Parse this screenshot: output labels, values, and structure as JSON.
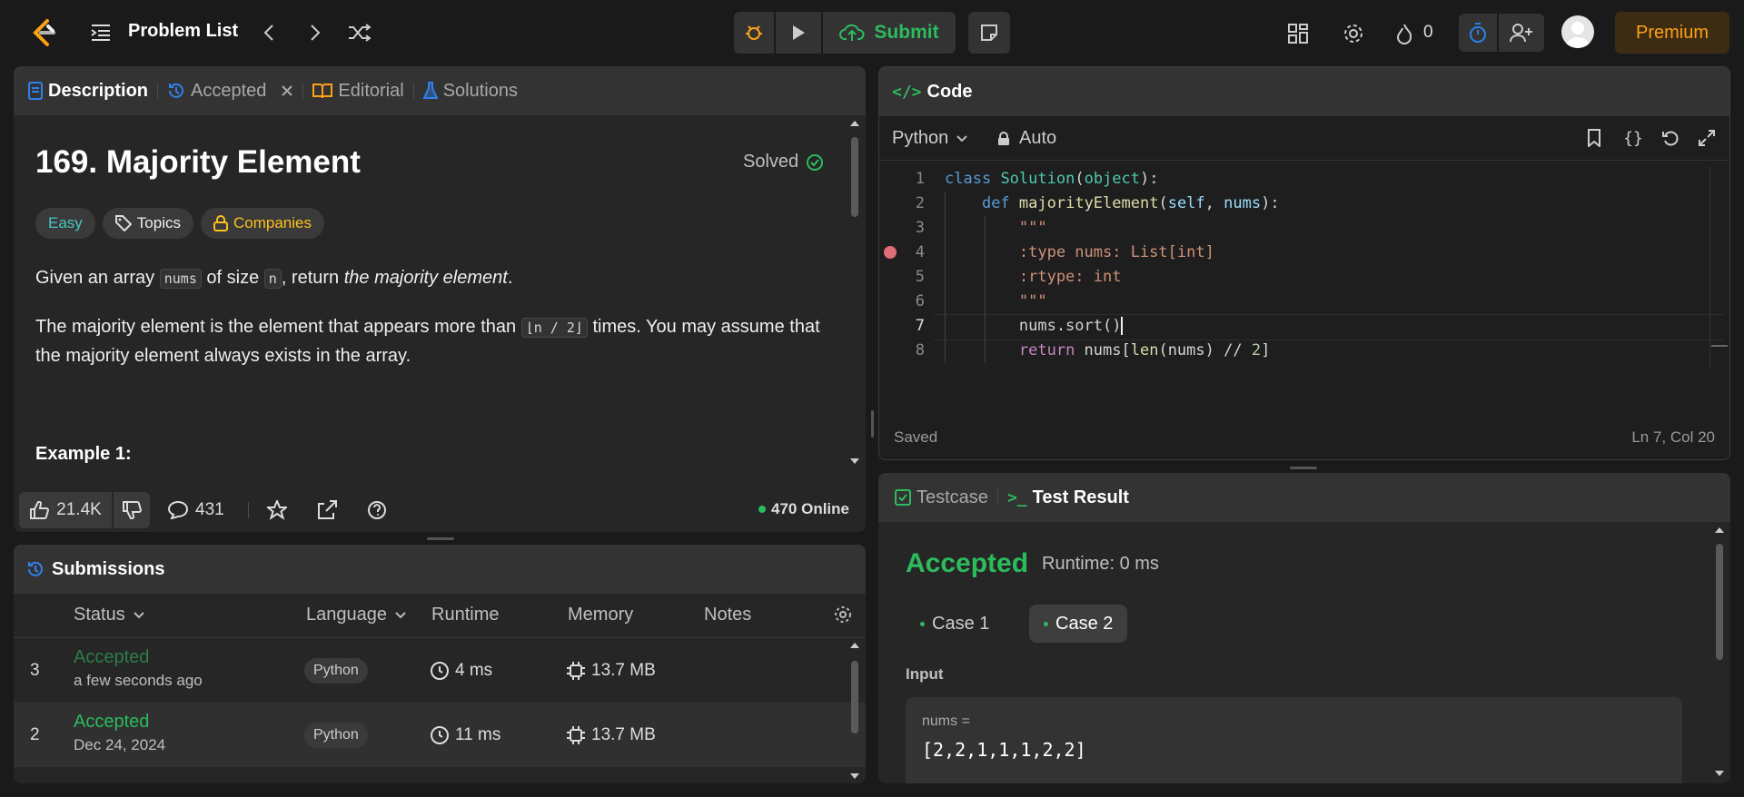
{
  "topbar": {
    "problem_list": "Problem List",
    "submit": "Submit",
    "streak": "0",
    "premium": "Premium"
  },
  "desc_panel": {
    "tabs": [
      "Description",
      "Accepted",
      "Editorial",
      "Solutions"
    ],
    "title": "169. Majority Element",
    "solved": "Solved",
    "tags": {
      "difficulty": "Easy",
      "topics": "Topics",
      "companies": "Companies"
    },
    "p1_a": "Given an array ",
    "p1_code1": "nums",
    "p1_b": " of size ",
    "p1_code2": "n",
    "p1_c": ", return ",
    "p1_em": "the majority element",
    "p1_d": ".",
    "p2_a": "The majority element is the element that appears more than ",
    "p2_code": "⌊n / 2⌋",
    "p2_b": " times. You may assume that the majority element always exists in the array.",
    "example": "Example 1:",
    "likes": "21.4K",
    "comments": "431",
    "online": "470 Online"
  },
  "submissions": {
    "title": "Submissions",
    "headers": {
      "status": "Status",
      "language": "Language",
      "runtime": "Runtime",
      "memory": "Memory",
      "notes": "Notes"
    },
    "rows": [
      {
        "num": "3",
        "status": "Accepted",
        "time": "a few seconds ago",
        "language": "Python",
        "runtime": "4 ms",
        "memory": "13.7 MB"
      },
      {
        "num": "2",
        "status": "Accepted",
        "time": "Dec 24, 2024",
        "language": "Python",
        "runtime": "11 ms",
        "memory": "13.7 MB"
      }
    ]
  },
  "code_panel": {
    "title": "Code",
    "language": "Python",
    "mode": "Auto",
    "saved": "Saved",
    "cursor": "Ln 7, Col 20",
    "line_numbers": [
      "1",
      "2",
      "3",
      "4",
      "5",
      "6",
      "7",
      "8"
    ]
  },
  "result_panel": {
    "tab_testcase": "Testcase",
    "tab_result": "Test Result",
    "status": "Accepted",
    "runtime": "Runtime: 0 ms",
    "case1": "Case 1",
    "case2": "Case 2",
    "input_label": "Input",
    "var_label": "nums =",
    "var_value": "[2,2,1,1,1,2,2]"
  },
  "colors": {
    "green": "#2cbb5d",
    "easy": "#46c6c2",
    "orange": "#ffc01e",
    "blue": "#2f80ed"
  }
}
